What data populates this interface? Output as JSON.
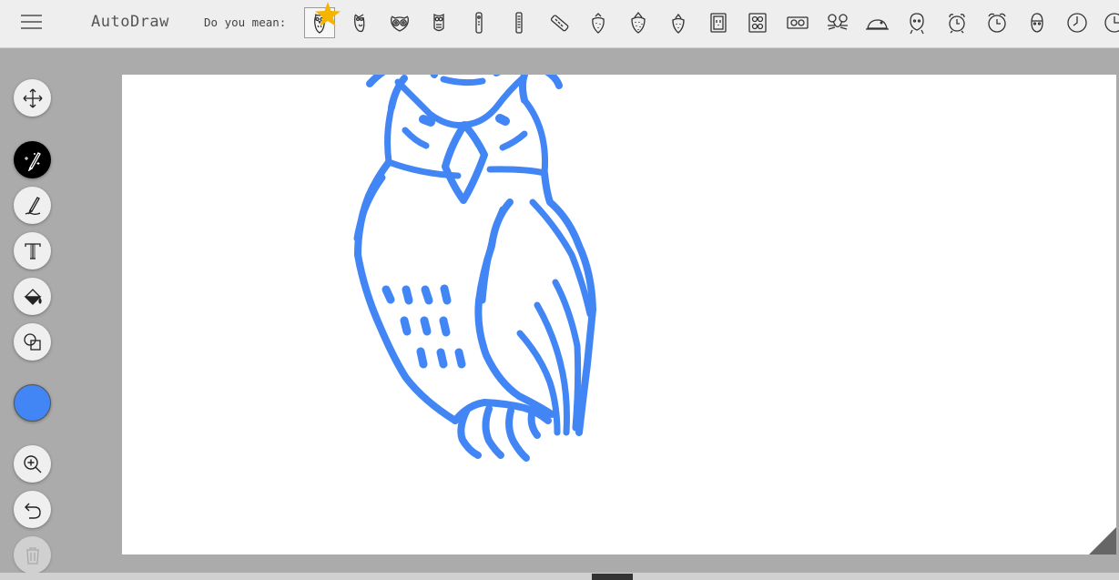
{
  "app": {
    "title": "AutoDraw"
  },
  "suggestions": {
    "prompt": "Do you mean:",
    "items": [
      "owl",
      "owl",
      "owl",
      "owl",
      "remote",
      "remote",
      "remote",
      "strawberry",
      "strawberry",
      "strawberry",
      "outlet",
      "outlet",
      "outlet",
      "mouse",
      "mouse",
      "face",
      "alarm-clock",
      "alarm-clock",
      "face",
      "clock",
      "clock"
    ],
    "selected_index": 0
  },
  "tools": [
    {
      "name": "move-tool",
      "icon": "move-icon"
    },
    {
      "name": "autodraw-tool",
      "icon": "autodraw-pencil-icon",
      "active": true
    },
    {
      "name": "draw-tool",
      "icon": "pencil-icon"
    },
    {
      "name": "type-tool",
      "icon": "text-icon"
    },
    {
      "name": "fill-tool",
      "icon": "paint-bucket-icon"
    },
    {
      "name": "shape-tool",
      "icon": "shapes-icon"
    },
    {
      "name": "color-picker",
      "icon": "color-swatch"
    },
    {
      "name": "zoom-tool",
      "icon": "zoom-icon"
    },
    {
      "name": "undo-tool",
      "icon": "undo-icon"
    },
    {
      "name": "delete-tool",
      "icon": "trash-icon",
      "disabled": true
    }
  ],
  "colors": {
    "stroke": "#4285f4",
    "selected_color": "#4285f4",
    "star": "#f4b400",
    "canvas": "#ffffff",
    "background": "#ababab"
  }
}
